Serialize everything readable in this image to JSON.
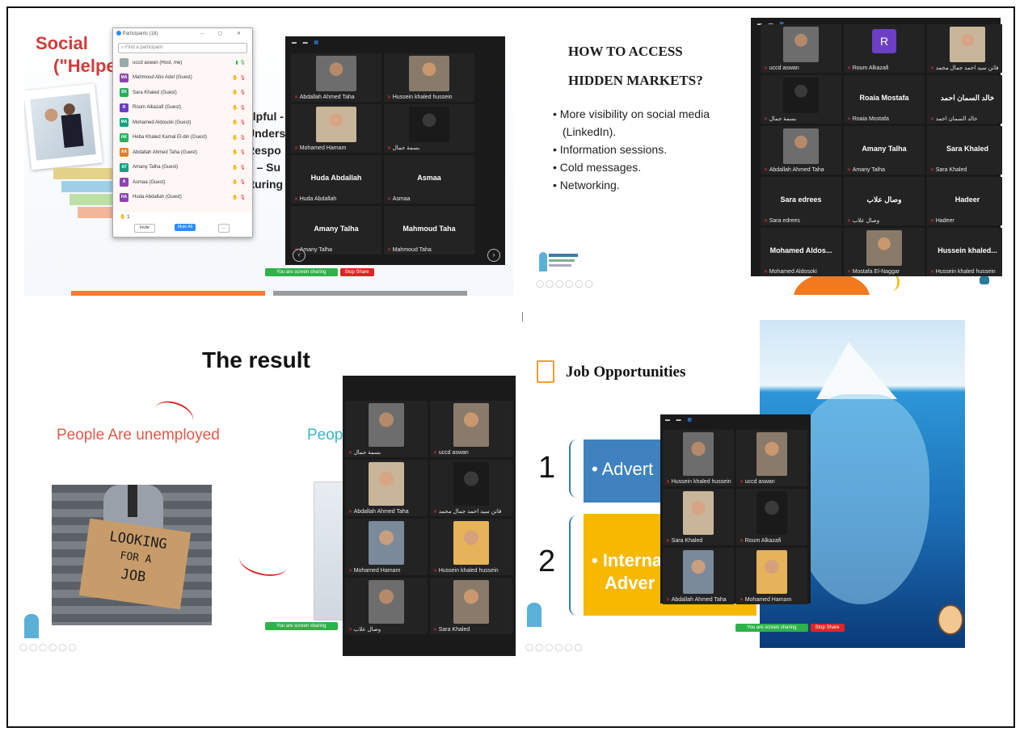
{
  "panel1": {
    "title_line1": "Social",
    "title_line2": "(\"Helpe",
    "text_lines": [
      "elpful -",
      "Unders",
      "Respo",
      "d – Su",
      "rturing"
    ],
    "participants": {
      "header": "Participants (18)",
      "search_placeholder": "Find a participant",
      "rows": [
        {
          "initials": "",
          "name": "uccd aswan (Host, me)",
          "color": "#9aa"
        },
        {
          "initials": "MA",
          "name": "Mahmoud Abo Adel (Guest)",
          "color": "#8e44ad"
        },
        {
          "initials": "SK",
          "name": "Sara Khaled (Guest)",
          "color": "#27ae60"
        },
        {
          "initials": "R",
          "name": "Roum Alkazafi (Guest)",
          "color": "#6c3fc4"
        },
        {
          "initials": "MA",
          "name": "Mohamed Aldosoki (Guest)",
          "color": "#16a085"
        },
        {
          "initials": "HK",
          "name": "Heba Khaled Kamal El-din (Guest)",
          "color": "#27ae60"
        },
        {
          "initials": "AA",
          "name": "Abdallah Ahmed Taha (Guest)",
          "color": "#e67e22"
        },
        {
          "initials": "AT",
          "name": "Amany Talha (Guest)",
          "color": "#16a085"
        },
        {
          "initials": "A",
          "name": "Asmaa (Guest)",
          "color": "#8e44ad"
        },
        {
          "initials": "HA",
          "name": "Huda Abdallah (Guest)",
          "color": "#8e44ad"
        }
      ],
      "count_badge": "1",
      "invite_label": "Invite",
      "mute_all_label": "Mute All",
      "more_label": "..."
    },
    "video_tiles": [
      {
        "name": "Abdallah Ahmed Taha",
        "big": ""
      },
      {
        "name": "Hussein khaled hussein",
        "big": ""
      },
      {
        "name": "Mohamed Hamam",
        "big": ""
      },
      {
        "name": "بسمة جمال",
        "big": ""
      },
      {
        "name": "Huda Abdallah",
        "big": "Huda Abdallah"
      },
      {
        "name": "Asmaa",
        "big": "Asmaa"
      },
      {
        "name": "Amany Talha",
        "big": "Amany Talha"
      },
      {
        "name": "Mahmoud Taha",
        "big": "Mahmoud Taha"
      }
    ],
    "share_text": "You are screen sharing",
    "stop_share": "Stop Share"
  },
  "panel2": {
    "heading1": "HOW TO ACCESS",
    "heading2": "HIDDEN MARKETS?",
    "bullets": [
      "More visibility on social media",
      "(LinkedIn).",
      "Information sessions.",
      "Cold messages.",
      "Networking."
    ],
    "video_tiles": [
      {
        "name": "uccd aswan",
        "big": ""
      },
      {
        "name": "Roum Alkazafi",
        "big": "R"
      },
      {
        "name": "فاتن سيد احمد جمال محمد",
        "big": ""
      },
      {
        "name": "بسمة جمال",
        "big": ""
      },
      {
        "name": "Roaia Mostafa",
        "big": "Roaia Mostafa"
      },
      {
        "name": "خالد السمان احمد",
        "big": "خالد السمان احمد"
      },
      {
        "name": "Abdallah Ahmed Taha",
        "big": ""
      },
      {
        "name": "Amany Talha",
        "big": "Amany Talha"
      },
      {
        "name": "Sara Khaled",
        "big": "Sara Khaled"
      },
      {
        "name": "Sara edrees",
        "big": "Sara edrees"
      },
      {
        "name": "وصال علاب",
        "big": "وصال علاب"
      },
      {
        "name": "Hadeer",
        "big": "Hadeer"
      },
      {
        "name": "Mohamed Aldosoki",
        "big": "Mohamed Aldos..."
      },
      {
        "name": "Mostafa El-Naggar",
        "big": ""
      },
      {
        "name": "Hussein khaled hussein",
        "big": "Hussein khaled..."
      }
    ]
  },
  "panel3": {
    "title": "The result",
    "left_text": "People Are unemployed",
    "right_text": "Peop",
    "sign_line1": "LOOKING",
    "sign_line2": "FOR A",
    "sign_line3": "JOB",
    "video_tiles": [
      {
        "name": "بسمة جمال"
      },
      {
        "name": "uccd aswan"
      },
      {
        "name": "Abdallah Ahmed Taha"
      },
      {
        "name": "فاتن سيد احمد جمال محمد"
      },
      {
        "name": "Mohamed Hamam"
      },
      {
        "name": "Hussein khaled hussein"
      },
      {
        "name": "وصال علاب"
      },
      {
        "name": "Sara Khaled"
      }
    ],
    "share_text": "You are screen sharing"
  },
  "panel4": {
    "title": "Job Opportunities",
    "num1": "1",
    "num2": "2",
    "box1": "• Advert",
    "box2_line1": "• Interna",
    "box2_line2": "Adver",
    "video_tiles": [
      {
        "name": "Hussein khaled hussein"
      },
      {
        "name": "uccd aswan"
      },
      {
        "name": "Sara Khaled"
      },
      {
        "name": "Roum Alkazafi"
      },
      {
        "name": "Abdallah Ahmed Taha"
      },
      {
        "name": "Mohamed Hamam"
      }
    ],
    "share_text": "You are screen sharing",
    "stop_share": "Stop Share"
  }
}
